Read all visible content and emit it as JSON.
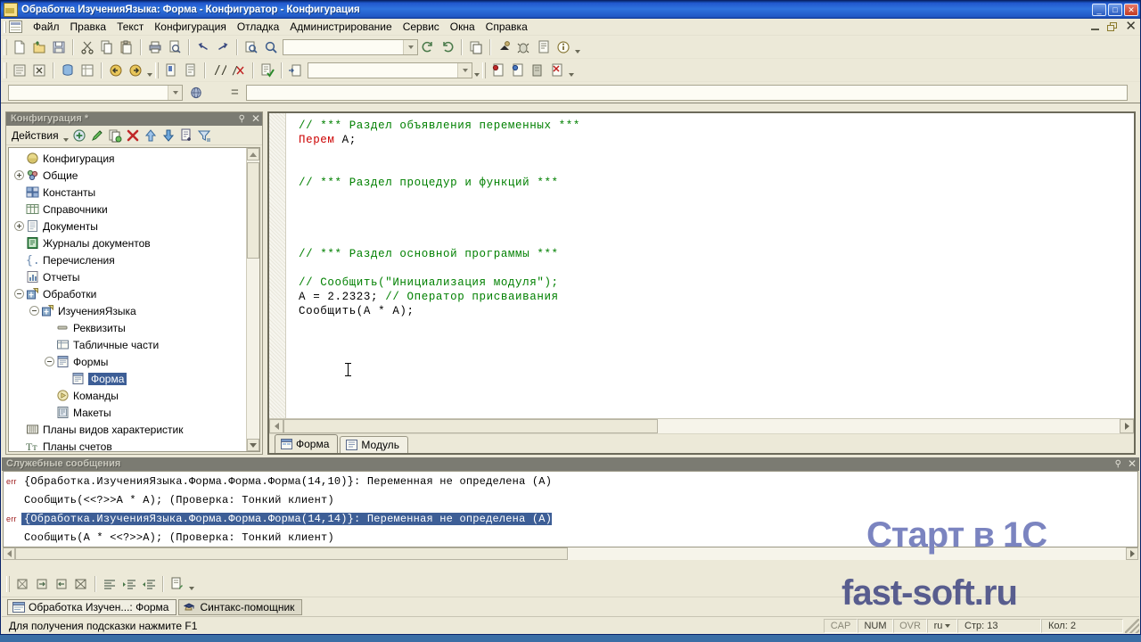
{
  "window": {
    "title": "Обработка ИзученияЯзыка: Форма - Конфигуратор - Конфигурация",
    "icon": "app-icon",
    "minimize": "_",
    "maximize": "□",
    "close": "✕"
  },
  "menu": {
    "items": [
      {
        "label": "Файл",
        "accel": "Ф"
      },
      {
        "label": "Правка",
        "accel": "П"
      },
      {
        "label": "Текст",
        "accel": "Т"
      },
      {
        "label": "Конфигурация",
        "accel": "К"
      },
      {
        "label": "Отладка",
        "accel": "О"
      },
      {
        "label": "Администрирование",
        "accel": "А"
      },
      {
        "label": "Сервис",
        "accel": "С"
      },
      {
        "label": "Окна",
        "accel": "О"
      },
      {
        "label": "Справка",
        "accel": "С"
      }
    ],
    "mdi": {
      "minimize": "_",
      "restore": "❐",
      "close": "✕"
    }
  },
  "toolbar_row1": {
    "buttons": [
      "new-document-icon",
      "open-folder-icon",
      "save-icon",
      "cut-scissors-icon",
      "copy-icon",
      "paste-icon",
      "print-icon",
      "print-preview-icon",
      "undo-arrow-icon",
      "redo-arrow-icon",
      "find-in-file-icon",
      "search-magnifier-icon"
    ],
    "combo_value": "",
    "buttons_tail": [
      "refresh-ccw-icon",
      "refresh-cw-icon",
      "window-list-icon",
      "debug-start-icon",
      "debug-config-icon",
      "syntax-helper-icon",
      "about-info-icon"
    ]
  },
  "toolbar_row2": {
    "buttons": [
      "module-window-icon",
      "close-module-icon",
      "db-config-icon",
      "table-config-icon",
      "back-nav-icon",
      "forward-nav-icon"
    ],
    "buttons2": [
      "bookmark-add-icon",
      "bookmark-list-icon",
      "comment-block-icon",
      "uncomment-block-icon",
      "syntax-check-icon",
      "goto-line-icon"
    ],
    "combo_value": "",
    "buttons3": [
      "breakpoint-icon",
      "breakpoint-condition-icon",
      "step-over-icon",
      "remove-breakpoints-icon"
    ]
  },
  "toolbar_row3": {
    "combo_value": "",
    "globe_icon": "globe-icon",
    "equals_icon": "equals-icon",
    "expression_value": ""
  },
  "tree_panel": {
    "title": "Конфигурация *",
    "pin_icon": "pin-icon",
    "close_icon": "close-icon",
    "actions_label": "Действия",
    "tool_icons": [
      "add-icon",
      "edit-pencil-icon",
      "copy-item-icon",
      "delete-x-icon",
      "move-up-icon",
      "move-down-icon",
      "properties-icon",
      "filter-icon"
    ],
    "nodes": [
      {
        "label": "Конфигурация",
        "indent": 0,
        "toggle": "none",
        "icon": "config-root-icon",
        "selected": false
      },
      {
        "label": "Общие",
        "indent": 0,
        "toggle": "plus",
        "icon": "common-icon",
        "selected": false
      },
      {
        "label": "Константы",
        "indent": 0,
        "toggle": "none",
        "icon": "constants-icon",
        "selected": false
      },
      {
        "label": "Справочники",
        "indent": 0,
        "toggle": "none",
        "icon": "catalogs-icon",
        "selected": false
      },
      {
        "label": "Документы",
        "indent": 0,
        "toggle": "plus",
        "icon": "documents-icon",
        "selected": false
      },
      {
        "label": "Журналы документов",
        "indent": 0,
        "toggle": "none",
        "icon": "doc-journals-icon",
        "selected": false
      },
      {
        "label": "Перечисления",
        "indent": 0,
        "toggle": "none",
        "icon": "enums-icon",
        "selected": false
      },
      {
        "label": "Отчеты",
        "indent": 0,
        "toggle": "none",
        "icon": "reports-icon",
        "selected": false
      },
      {
        "label": "Обработки",
        "indent": 0,
        "toggle": "minus",
        "icon": "dataprocessors-icon",
        "selected": false
      },
      {
        "label": "ИзученияЯзыка",
        "indent": 1,
        "toggle": "minus",
        "icon": "dataprocessor-icon",
        "selected": false
      },
      {
        "label": "Реквизиты",
        "indent": 2,
        "toggle": "none",
        "icon": "attributes-icon",
        "selected": false
      },
      {
        "label": "Табличные части",
        "indent": 2,
        "toggle": "none",
        "icon": "tabular-sections-icon",
        "selected": false
      },
      {
        "label": "Формы",
        "indent": 2,
        "toggle": "minus",
        "icon": "forms-folder-icon",
        "selected": false
      },
      {
        "label": "Форма",
        "indent": 3,
        "toggle": "none",
        "icon": "form-icon",
        "selected": true
      },
      {
        "label": "Команды",
        "indent": 2,
        "toggle": "none",
        "icon": "commands-icon",
        "selected": false
      },
      {
        "label": "Макеты",
        "indent": 2,
        "toggle": "none",
        "icon": "templates-icon",
        "selected": false
      },
      {
        "label": "Планы видов характеристик",
        "indent": 0,
        "toggle": "none",
        "icon": "chart-of-characteristic-types-icon",
        "selected": false
      },
      {
        "label": "Планы счетов",
        "indent": 0,
        "toggle": "none",
        "icon": "chart-of-accounts-icon",
        "selected": false
      }
    ]
  },
  "editor": {
    "lines": [
      [
        {
          "t": "// *** Раздел объявления переменных ***",
          "c": "com"
        }
      ],
      [
        {
          "t": "Перем",
          "c": "kw"
        },
        {
          "t": " А;",
          "c": "txt"
        }
      ],
      [],
      [],
      [
        {
          "t": "// *** Раздел процедур и функций ***",
          "c": "com"
        }
      ],
      [],
      [],
      [],
      [],
      [
        {
          "t": "// *** Раздел основной программы ***",
          "c": "com"
        }
      ],
      [],
      [
        {
          "t": "// Сообщить(\"Инициализация модуля\");",
          "c": "com"
        }
      ],
      [
        {
          "t": "А = 2.2323; ",
          "c": "txt"
        },
        {
          "t": "// Оператор присваивания",
          "c": "com"
        }
      ],
      [
        {
          "t": "Сообщить(А * А);",
          "c": "txt"
        }
      ]
    ],
    "tabs": [
      {
        "label": "Форма",
        "icon": "form-designer-icon",
        "active": true
      },
      {
        "label": "Модуль",
        "icon": "module-icon",
        "active": false
      }
    ]
  },
  "messages": {
    "title": "Служебные сообщения",
    "pin_icon": "pin-icon",
    "close_icon": "close-icon",
    "lines": [
      {
        "badge": "err",
        "text": "{Обработка.ИзученияЯзыка.Форма.Форма.Форма(14,10)}: Переменная не определена (А)",
        "selected": false
      },
      {
        "badge": "",
        "text": "Сообщить(<<?>>А * А); (Проверка: Тонкий клиент)",
        "selected": false
      },
      {
        "badge": "err",
        "text": "{Обработка.ИзученияЯзыка.Форма.Форма.Форма(14,14)}: Переменная не определена (А)",
        "selected": true
      },
      {
        "badge": "",
        "text": "Сообщить(А * <<?>>А); (Проверка: Тонкий клиент)",
        "selected": false
      }
    ]
  },
  "bottom_toolbar": {
    "icons": [
      "clear-messages-icon",
      "next-message-icon",
      "prev-message-icon",
      "clear-all-messages-icon",
      "align-left-icon",
      "indent-increase-icon",
      "indent-decrease-icon",
      "save-messages-icon"
    ]
  },
  "window_tabs": [
    {
      "label": "Обработка Изучен...: Форма",
      "icon": "form-window-icon",
      "active": true
    },
    {
      "label": "Синтакс-помощник",
      "icon": "syntax-helper-window-icon",
      "active": false
    }
  ],
  "statusbar": {
    "hint": "Для получения подсказки нажмите F1",
    "caps": "CAP",
    "num": "NUM",
    "ovr": "OVR",
    "lang": "ru",
    "row": "Стр: 13",
    "col": "Кол: 2"
  },
  "watermark": {
    "line1": "Старт в 1С",
    "line2": "fast-soft.ru"
  },
  "colors": {
    "title_bar": "#2158ce",
    "comment": "#008000",
    "keyword": "#cc0000",
    "selection": "#3d5e96",
    "panel_bg": "#ece9d8",
    "panel_header": "#7b7b72"
  }
}
